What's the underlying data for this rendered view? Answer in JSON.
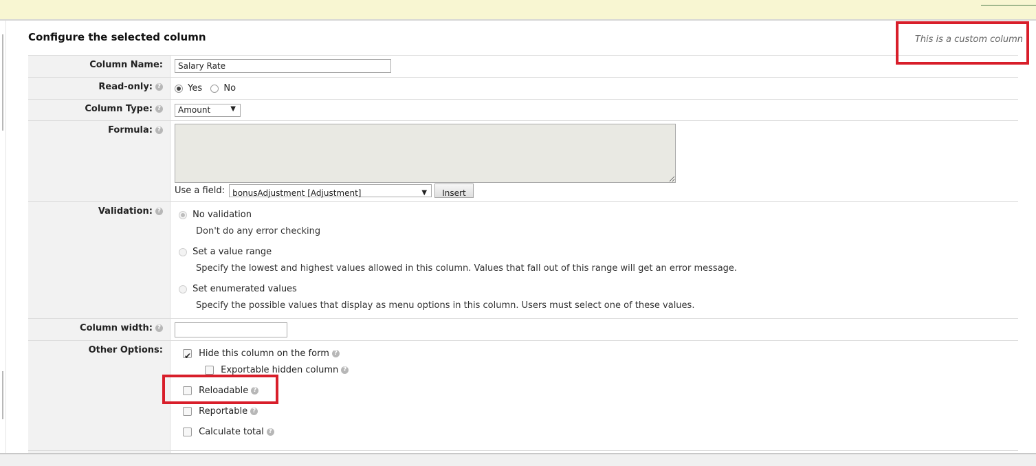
{
  "panel": {
    "title": "Configure the selected column",
    "custom_note": "This is a custom column"
  },
  "help_glyph": "?",
  "form": {
    "column_name": {
      "label": "Column Name:",
      "value": "Salary Rate"
    },
    "read_only": {
      "label": "Read-only:",
      "options": [
        "Yes",
        "No"
      ],
      "selected": "Yes"
    },
    "column_type": {
      "label": "Column Type:",
      "selected": "Amount",
      "arrow": "▼"
    },
    "formula": {
      "label": "Formula:",
      "value": "",
      "use_field_label": "Use a field:",
      "field_selected": "bonusAdjustment [Adjustment]",
      "field_arrow": "▼",
      "insert_button": "Insert"
    },
    "validation": {
      "label": "Validation:",
      "selected": "No validation",
      "options": [
        {
          "title": "No validation",
          "description": "Don't do any error checking"
        },
        {
          "title": "Set a value range",
          "description": "Specify the lowest and highest values allowed in this column. Values that fall out of this range will get an error message."
        },
        {
          "title": "Set enumerated values",
          "description": "Specify the possible values that display as menu options in this column. Users must select one of these values."
        }
      ]
    },
    "column_width": {
      "label": "Column width:",
      "value": ""
    },
    "other_options": {
      "label": "Other Options:",
      "items": [
        {
          "label": "Hide this column on the form",
          "checked": true
        },
        {
          "label": "Exportable hidden column",
          "checked": false
        },
        {
          "label": "Reloadable",
          "checked": false
        },
        {
          "label": "Reportable",
          "checked": false
        },
        {
          "label": "Calculate total",
          "checked": false
        }
      ]
    }
  },
  "colors": {
    "highlight": "#d81e2a",
    "topbar": "#f8f6d2",
    "label_bg": "#f2f2f2"
  }
}
